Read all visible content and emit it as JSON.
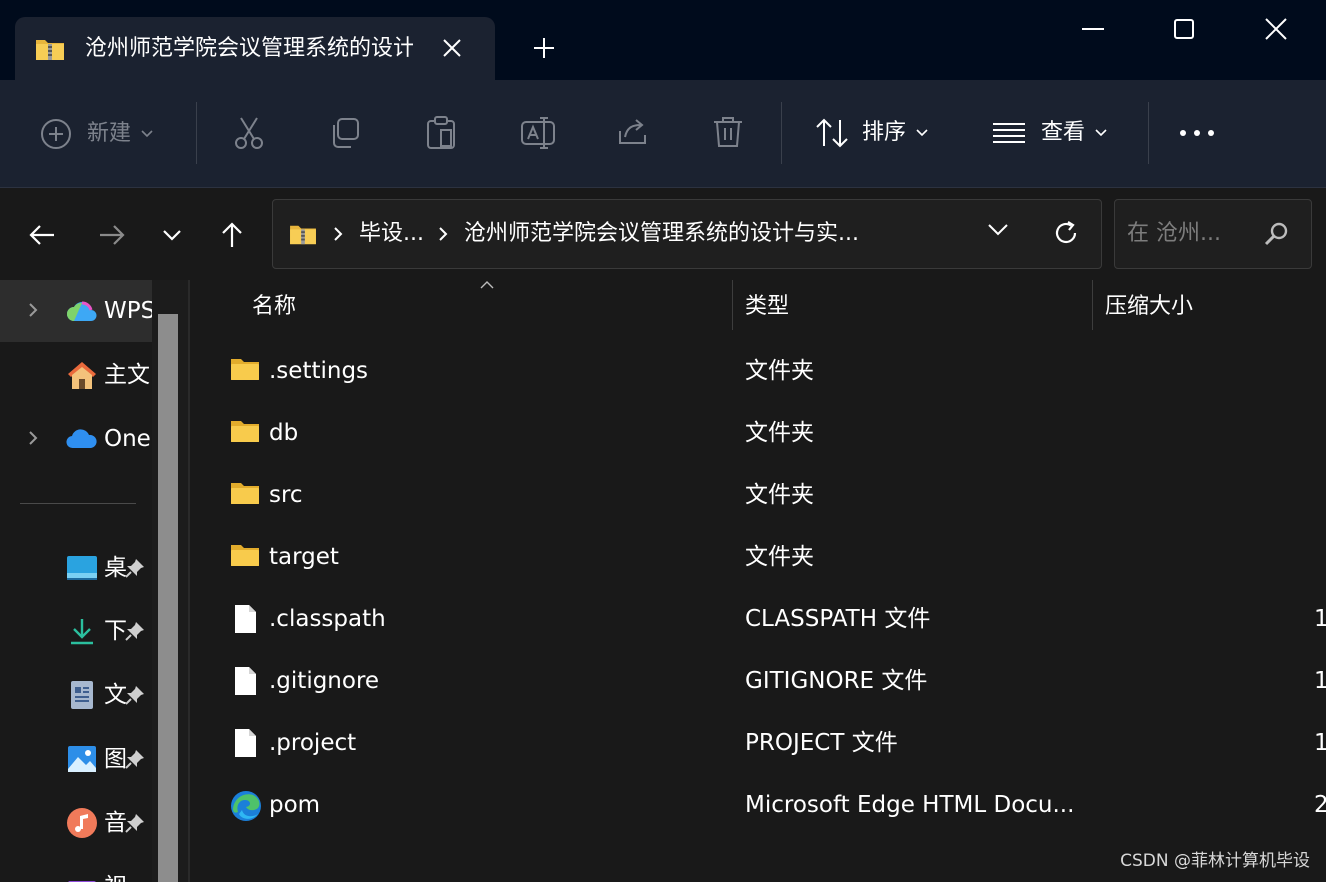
{
  "window": {
    "tab_title": "沧州师范学院会议管理系统的设计与实现",
    "tab_icon": "zip-folder-icon"
  },
  "toolbar": {
    "new_label": "新建",
    "sort_label": "排序",
    "view_label": "查看"
  },
  "address": {
    "crumbs": [
      "毕设...",
      "沧州师范学院会议管理系统的设计与实..."
    ],
    "search_placeholder": "在 沧州..."
  },
  "sidebar": {
    "top_items": [
      {
        "label": "WPS",
        "icon": "wps-cloud-icon",
        "expandable": true,
        "selected": true
      },
      {
        "label": "主文",
        "icon": "home-icon",
        "expandable": false,
        "selected": false
      },
      {
        "label": "One",
        "icon": "onedrive-cloud-icon",
        "expandable": true,
        "selected": false
      }
    ],
    "quick_access": [
      {
        "label": "桌",
        "icon": "desktop-icon"
      },
      {
        "label": "下",
        "icon": "download-icon"
      },
      {
        "label": "文",
        "icon": "documents-icon"
      },
      {
        "label": "图",
        "icon": "pictures-icon"
      },
      {
        "label": "音",
        "icon": "music-icon"
      },
      {
        "label": "视",
        "icon": "videos-icon"
      }
    ]
  },
  "columns": {
    "name": "名称",
    "type": "类型",
    "size": "压缩大小"
  },
  "files": [
    {
      "name": ".settings",
      "type": "文件夹",
      "size": "",
      "icon": "folder-icon"
    },
    {
      "name": "db",
      "type": "文件夹",
      "size": "",
      "icon": "folder-icon"
    },
    {
      "name": "src",
      "type": "文件夹",
      "size": "",
      "icon": "folder-icon"
    },
    {
      "name": "target",
      "type": "文件夹",
      "size": "",
      "icon": "folder-icon"
    },
    {
      "name": ".classpath",
      "type": "CLASSPATH 文件",
      "size": "1",
      "icon": "file-icon"
    },
    {
      "name": ".gitignore",
      "type": "GITIGNORE 文件",
      "size": "1",
      "icon": "file-icon"
    },
    {
      "name": ".project",
      "type": "PROJECT 文件",
      "size": "1",
      "icon": "file-icon"
    },
    {
      "name": "pom",
      "type": "Microsoft Edge HTML Docu...",
      "size": "2",
      "icon": "edge-icon"
    }
  ],
  "watermark": "CSDN @菲林计算机毕设",
  "colors": {
    "titlebar_bg": "#000b1c",
    "toolbar_bg": "#1b2230",
    "content_bg": "#191919",
    "folder_yellow": "#f5c242",
    "accent_blue": "#4aa3f0"
  }
}
